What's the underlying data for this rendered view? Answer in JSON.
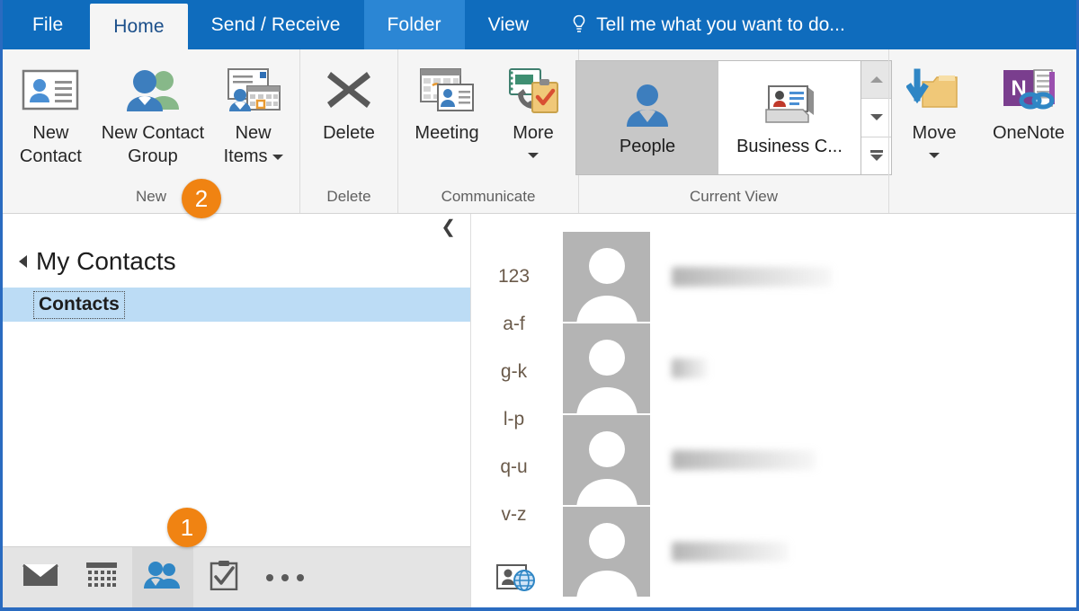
{
  "window": {
    "accent_color": "#0f6cbd",
    "border_color": "#2a6bc0"
  },
  "ribbon_tabs": [
    {
      "label": "File",
      "state": "file"
    },
    {
      "label": "Home",
      "state": "active"
    },
    {
      "label": "Send / Receive",
      "state": "normal"
    },
    {
      "label": "Folder",
      "state": "hover"
    },
    {
      "label": "View",
      "state": "normal"
    }
  ],
  "tell_me": {
    "placeholder": "Tell me what you want to do...",
    "icon": "lightbulb-icon"
  },
  "ribbon_groups": [
    {
      "label": "New",
      "buttons": [
        {
          "label": "New\nContact",
          "icon": "new-contact-icon",
          "has_caret": false
        },
        {
          "label": "New Contact\nGroup",
          "icon": "new-contact-group-icon",
          "has_caret": false
        },
        {
          "label": "New\nItems",
          "icon": "new-items-icon",
          "has_caret": true
        }
      ]
    },
    {
      "label": "Delete",
      "buttons": [
        {
          "label": "Delete",
          "icon": "delete-x-icon",
          "has_caret": false
        }
      ]
    },
    {
      "label": "Communicate",
      "buttons": [
        {
          "label": "Meeting",
          "icon": "meeting-icon",
          "has_caret": false
        },
        {
          "label": "More",
          "icon": "more-communicate-icon",
          "has_caret": true
        }
      ]
    },
    {
      "label": "Current View",
      "gallery": {
        "items": [
          {
            "label": "People",
            "icon": "people-view-icon",
            "selected": true
          },
          {
            "label": "Business C...",
            "icon": "business-card-view-icon",
            "selected": false
          }
        ],
        "scroll": [
          {
            "name": "gallery-scroll-up",
            "icon": "chevron-up-icon",
            "disabled": true
          },
          {
            "name": "gallery-scroll-down",
            "icon": "chevron-down-icon",
            "disabled": false
          },
          {
            "name": "gallery-more",
            "icon": "gallery-expand-icon",
            "disabled": false
          }
        ]
      }
    },
    {
      "label": "",
      "buttons": [
        {
          "label": "Move",
          "icon": "move-folder-icon",
          "has_caret": true
        },
        {
          "label": "OneNote",
          "icon": "onenote-icon",
          "has_caret": false
        }
      ]
    }
  ],
  "folder_pane": {
    "collapse_icon": "chevron-left-icon",
    "header": "My Contacts",
    "header_expander": "triangle-expanded-icon",
    "items": [
      {
        "label": "Contacts",
        "selected": true
      }
    ]
  },
  "module_bar": {
    "buttons": [
      {
        "name": "mail",
        "icon": "mail-icon",
        "active": false
      },
      {
        "name": "calendar",
        "icon": "calendar-icon",
        "active": false
      },
      {
        "name": "people",
        "icon": "people-icon",
        "active": true
      },
      {
        "name": "tasks",
        "icon": "tasks-clipboard-icon",
        "active": false
      },
      {
        "name": "more",
        "icon": "ellipsis-icon",
        "active": false
      }
    ]
  },
  "alpha_index": {
    "entries": [
      "123",
      "a-f",
      "g-k",
      "l-p",
      "q-u",
      "v-z"
    ],
    "footer_icon": "contact-card-globe-icon"
  },
  "contacts": [
    {
      "avatar": "default-person-avatar",
      "name_redacted": true,
      "name_width": "w1"
    },
    {
      "avatar": "default-person-avatar",
      "name_redacted": true,
      "name_width": "w2"
    },
    {
      "avatar": "default-person-avatar",
      "name_redacted": true,
      "name_width": "w3"
    },
    {
      "avatar": "default-person-avatar",
      "name_redacted": true,
      "name_width": "w4"
    }
  ],
  "callouts": [
    {
      "number": "1",
      "target": "people-module-button",
      "color": "#f08312"
    },
    {
      "number": "2",
      "target": "new-group",
      "color": "#f08312"
    }
  ]
}
